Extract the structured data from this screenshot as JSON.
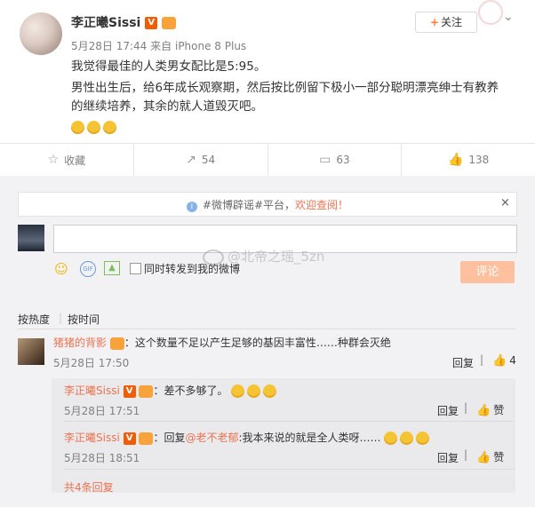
{
  "post": {
    "author": "李正曦Sissi",
    "verified_badge": "V",
    "time": "5月28日 17:44",
    "source_prefix": "来自",
    "source": "iPhone 8 Plus",
    "follow_label": "关注",
    "follow_plus": "+",
    "more_icon": "chevron-down",
    "lines": [
      "我觉得最佳的人类男女配比是5:95。",
      "男性出生后，给6年成长观察期，然后按比例留下极小一部分聪明漂亮绅士有教养",
      "的继续培养，其余的就人道毁灭吧。"
    ],
    "emoji_count": 3
  },
  "actions": {
    "favorite": "收藏",
    "repost": "54",
    "comment": "63",
    "like": "138"
  },
  "notice": {
    "prefix": "#微博辟谣#平台，",
    "accent": "欢迎查阅！",
    "close": "×",
    "accent_color": "#eb7350"
  },
  "composer": {
    "input_value": "",
    "also_repost_label": "同时转发到我的微博",
    "submit_label": "评论",
    "gif_label": "GIF"
  },
  "watermark": "@北帝之瑶_5zn",
  "sort": {
    "by_hot": "按热度",
    "by_time": "按时间"
  },
  "comments": [
    {
      "user": "猪猪的背影",
      "text": "：这个数量不足以产生足够的基因丰富性……种群会灭绝",
      "time": "5月28日 17:50",
      "reply_label": "回复",
      "likes": "4"
    }
  ],
  "replies": [
    {
      "user": "李正曦Sissi",
      "text": "：差不多够了。",
      "time": "5月28日 17:51",
      "reply_label": "回复",
      "like_label": "赞",
      "emoji_count": 3
    },
    {
      "user": "李正曦Sissi",
      "prefix": "：回复",
      "mention": "@老不老郁",
      "text": ":我本来说的就是全人类呀……",
      "time": "5月28日 18:51",
      "reply_label": "回复",
      "like_label": "赞",
      "emoji_count": 3
    }
  ],
  "more_replies": "共4条回复"
}
